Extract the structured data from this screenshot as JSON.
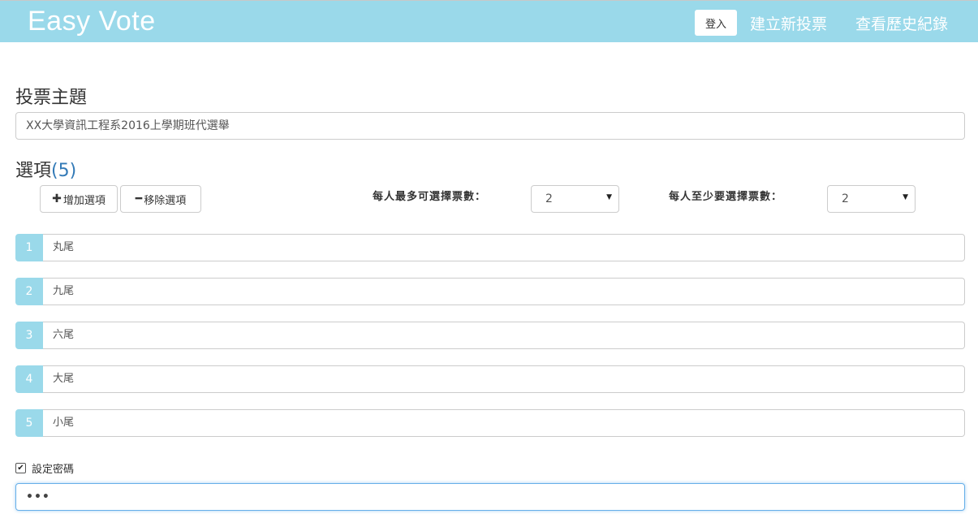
{
  "navbar": {
    "brand": "Easy Vote",
    "login": "登入",
    "create": "建立新投票",
    "history": "查看歷史紀錄"
  },
  "form": {
    "title_label": "投票主題",
    "title_value": "XX大學資訊工程系2016上學期班代選舉",
    "options_label": "選項",
    "options_count": "(5)",
    "add_option": "增加選項",
    "add_icon": "plus-icon",
    "remove_option": "移除選項",
    "remove_icon": "minus-icon",
    "max_votes_label": "每人最多可選擇票數：",
    "max_votes_value": "2",
    "min_votes_label": "每人至少要選擇票數：",
    "min_votes_value": "2",
    "options": [
      {
        "num": "1",
        "value": "丸尾"
      },
      {
        "num": "2",
        "value": "九尾"
      },
      {
        "num": "3",
        "value": "六尾"
      },
      {
        "num": "4",
        "value": "大尾"
      },
      {
        "num": "5",
        "value": "小尾"
      }
    ],
    "password_label": "設定密碼",
    "password_checked": true,
    "password_value": "•••"
  },
  "colors": {
    "navbar": "#9ad9ea",
    "accent_count": "#337ab7",
    "focus_border": "#66afe9"
  }
}
